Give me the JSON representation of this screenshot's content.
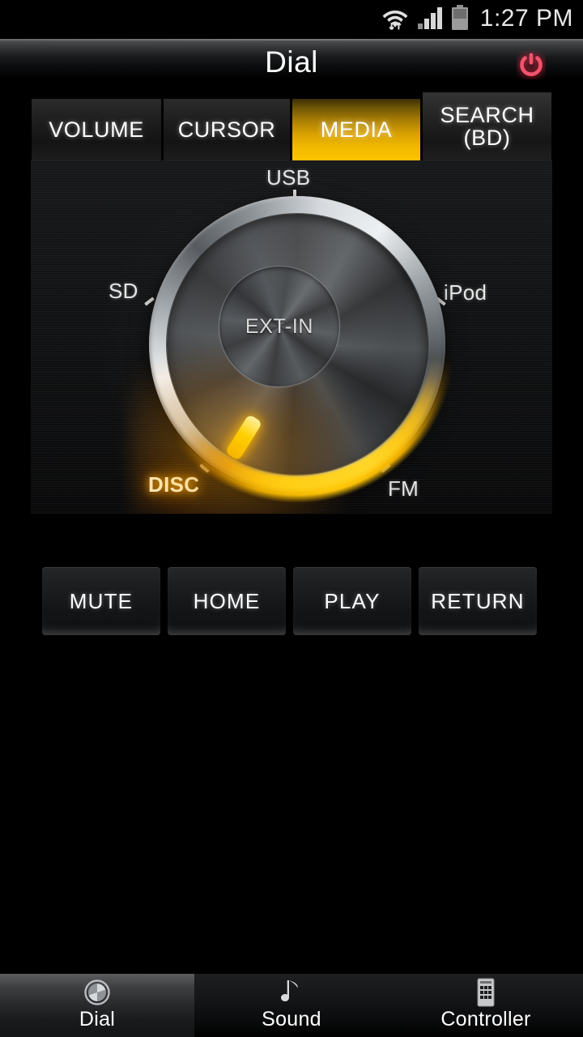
{
  "statusbar": {
    "time": "1:27 PM",
    "icons": [
      "wifi-sync-icon",
      "cellular-signal-icon",
      "battery-icon"
    ]
  },
  "titlebar": {
    "title": "Dial",
    "power_button": "power-icon"
  },
  "tabs": [
    {
      "id": "volume",
      "label": "VOLUME",
      "active": false
    },
    {
      "id": "cursor",
      "label": "CURSOR",
      "active": false
    },
    {
      "id": "media",
      "label": "MEDIA",
      "active": true
    },
    {
      "id": "search",
      "label_line1": "SEARCH",
      "label_line2": "(BD)",
      "active": false
    }
  ],
  "dial": {
    "center_label": "EXT-IN",
    "selected": "DISC",
    "positions": [
      {
        "id": "usb",
        "label": "USB",
        "angle_deg": 0,
        "selected": false
      },
      {
        "id": "ipod",
        "label": "iPod",
        "angle_deg": 65,
        "selected": false
      },
      {
        "id": "fm",
        "label": "FM",
        "angle_deg": 130,
        "selected": false
      },
      {
        "id": "disc",
        "label": "DISC",
        "angle_deg": 225,
        "selected": true
      },
      {
        "id": "sd",
        "label": "SD",
        "angle_deg": 295,
        "selected": false
      }
    ]
  },
  "actions": [
    {
      "id": "mute",
      "label": "MUTE"
    },
    {
      "id": "home",
      "label": "HOME"
    },
    {
      "id": "play",
      "label": "PLAY"
    },
    {
      "id": "return",
      "label": "RETURN"
    }
  ],
  "bottom_nav": [
    {
      "id": "dial",
      "label": "Dial",
      "icon": "knob-icon",
      "active": true
    },
    {
      "id": "sound",
      "label": "Sound",
      "icon": "music-note-icon",
      "active": false
    },
    {
      "id": "controller",
      "label": "Controller",
      "icon": "remote-icon",
      "active": false
    }
  ],
  "colors": {
    "accent_amber": "#ffc400",
    "active_tab_gold": "#f0b900",
    "power_red": "#e8415a",
    "text_primary": "#ffffff",
    "panel_bg": "#121314"
  }
}
